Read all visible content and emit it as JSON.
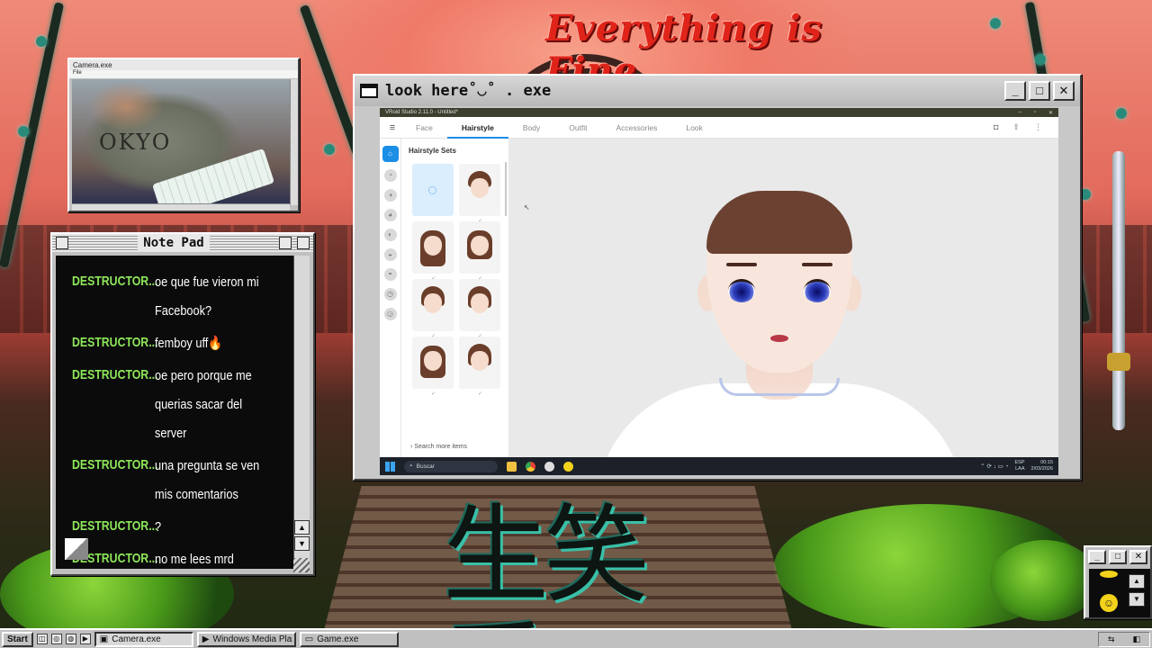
{
  "background": {
    "title_text": "Everything is Fine",
    "kanji_text": "生笑爱"
  },
  "camera_window": {
    "title": "Camera.exe",
    "menu": "File",
    "shirt_text": "OKYO"
  },
  "notepad": {
    "title": "Note Pad",
    "messages": [
      {
        "user": "DESTRUCTOR...",
        "text": "oe que fue vieron mi Facebook?"
      },
      {
        "user": "DESTRUCTOR...",
        "text": "femboy uff🔥"
      },
      {
        "user": "DESTRUCTOR...",
        "text": "oe pero porque me querias sacar del server"
      },
      {
        "user": "DESTRUCTOR...",
        "text": "una pregunta se ven mis comentarios"
      },
      {
        "user": "DESTRUCTOR...",
        "text": "?"
      },
      {
        "user": "DESTRUCTOR...",
        "text": "no me lees mrd"
      }
    ],
    "scroll_up": "▲",
    "scroll_down": "▼"
  },
  "lookhere_window": {
    "title": "look here˚◡˚ . exe",
    "minimize": "_",
    "maximize": "□",
    "close": "✕"
  },
  "vroid": {
    "window_title": "VRoid Studio 2.11.0 - Untitled*",
    "window_controls": [
      "–",
      "▫",
      "✕"
    ],
    "menu_icon": "≡",
    "tabs": [
      "Face",
      "Hairstyle",
      "Body",
      "Outfit",
      "Accessories",
      "Look"
    ],
    "active_tab": "Hairstyle",
    "tool_icons": [
      "camera-icon",
      "export-icon",
      "more-icon"
    ],
    "tool_glyphs": [
      "◘",
      "⇪",
      "⋮"
    ],
    "panel_title": "Hairstyle Sets",
    "search_more": "Search more items",
    "search_more_chevron": "›",
    "hair_check": "✓",
    "sidebar_glyphs": [
      "⌂",
      "◔",
      "◑",
      "◕",
      "◐",
      "◒",
      "◓",
      "◷",
      "◶"
    ],
    "taskbar": {
      "search_placeholder": "Buscar",
      "search_glyph": "⌕",
      "lang_line1": "ESP",
      "lang_line2": "LAA",
      "tray_glyphs": "⌃  ⟳  ↓  ▭  ◔",
      "time": "00:15",
      "date": "2/03/2026"
    }
  },
  "dock_window": {
    "minimize": "_",
    "maximize": "□",
    "close": "✕",
    "up": "▲",
    "down": "▼",
    "smiley": "☺"
  },
  "taskbar": {
    "start_label": "Start",
    "quick_launch_glyphs": [
      "◫",
      "◎",
      "◍",
      "▶"
    ],
    "items": [
      "Camera.exe",
      "Windows Media Pla",
      "Game.exe"
    ],
    "item_glyphs": [
      "▣",
      "▶",
      "▭"
    ],
    "tray_glyphs": [
      "⇆",
      "◧"
    ]
  },
  "colors": {
    "chat_user": "#8ee85a",
    "vroid_accent": "#1b8ee6",
    "title_red": "#e0241a"
  }
}
